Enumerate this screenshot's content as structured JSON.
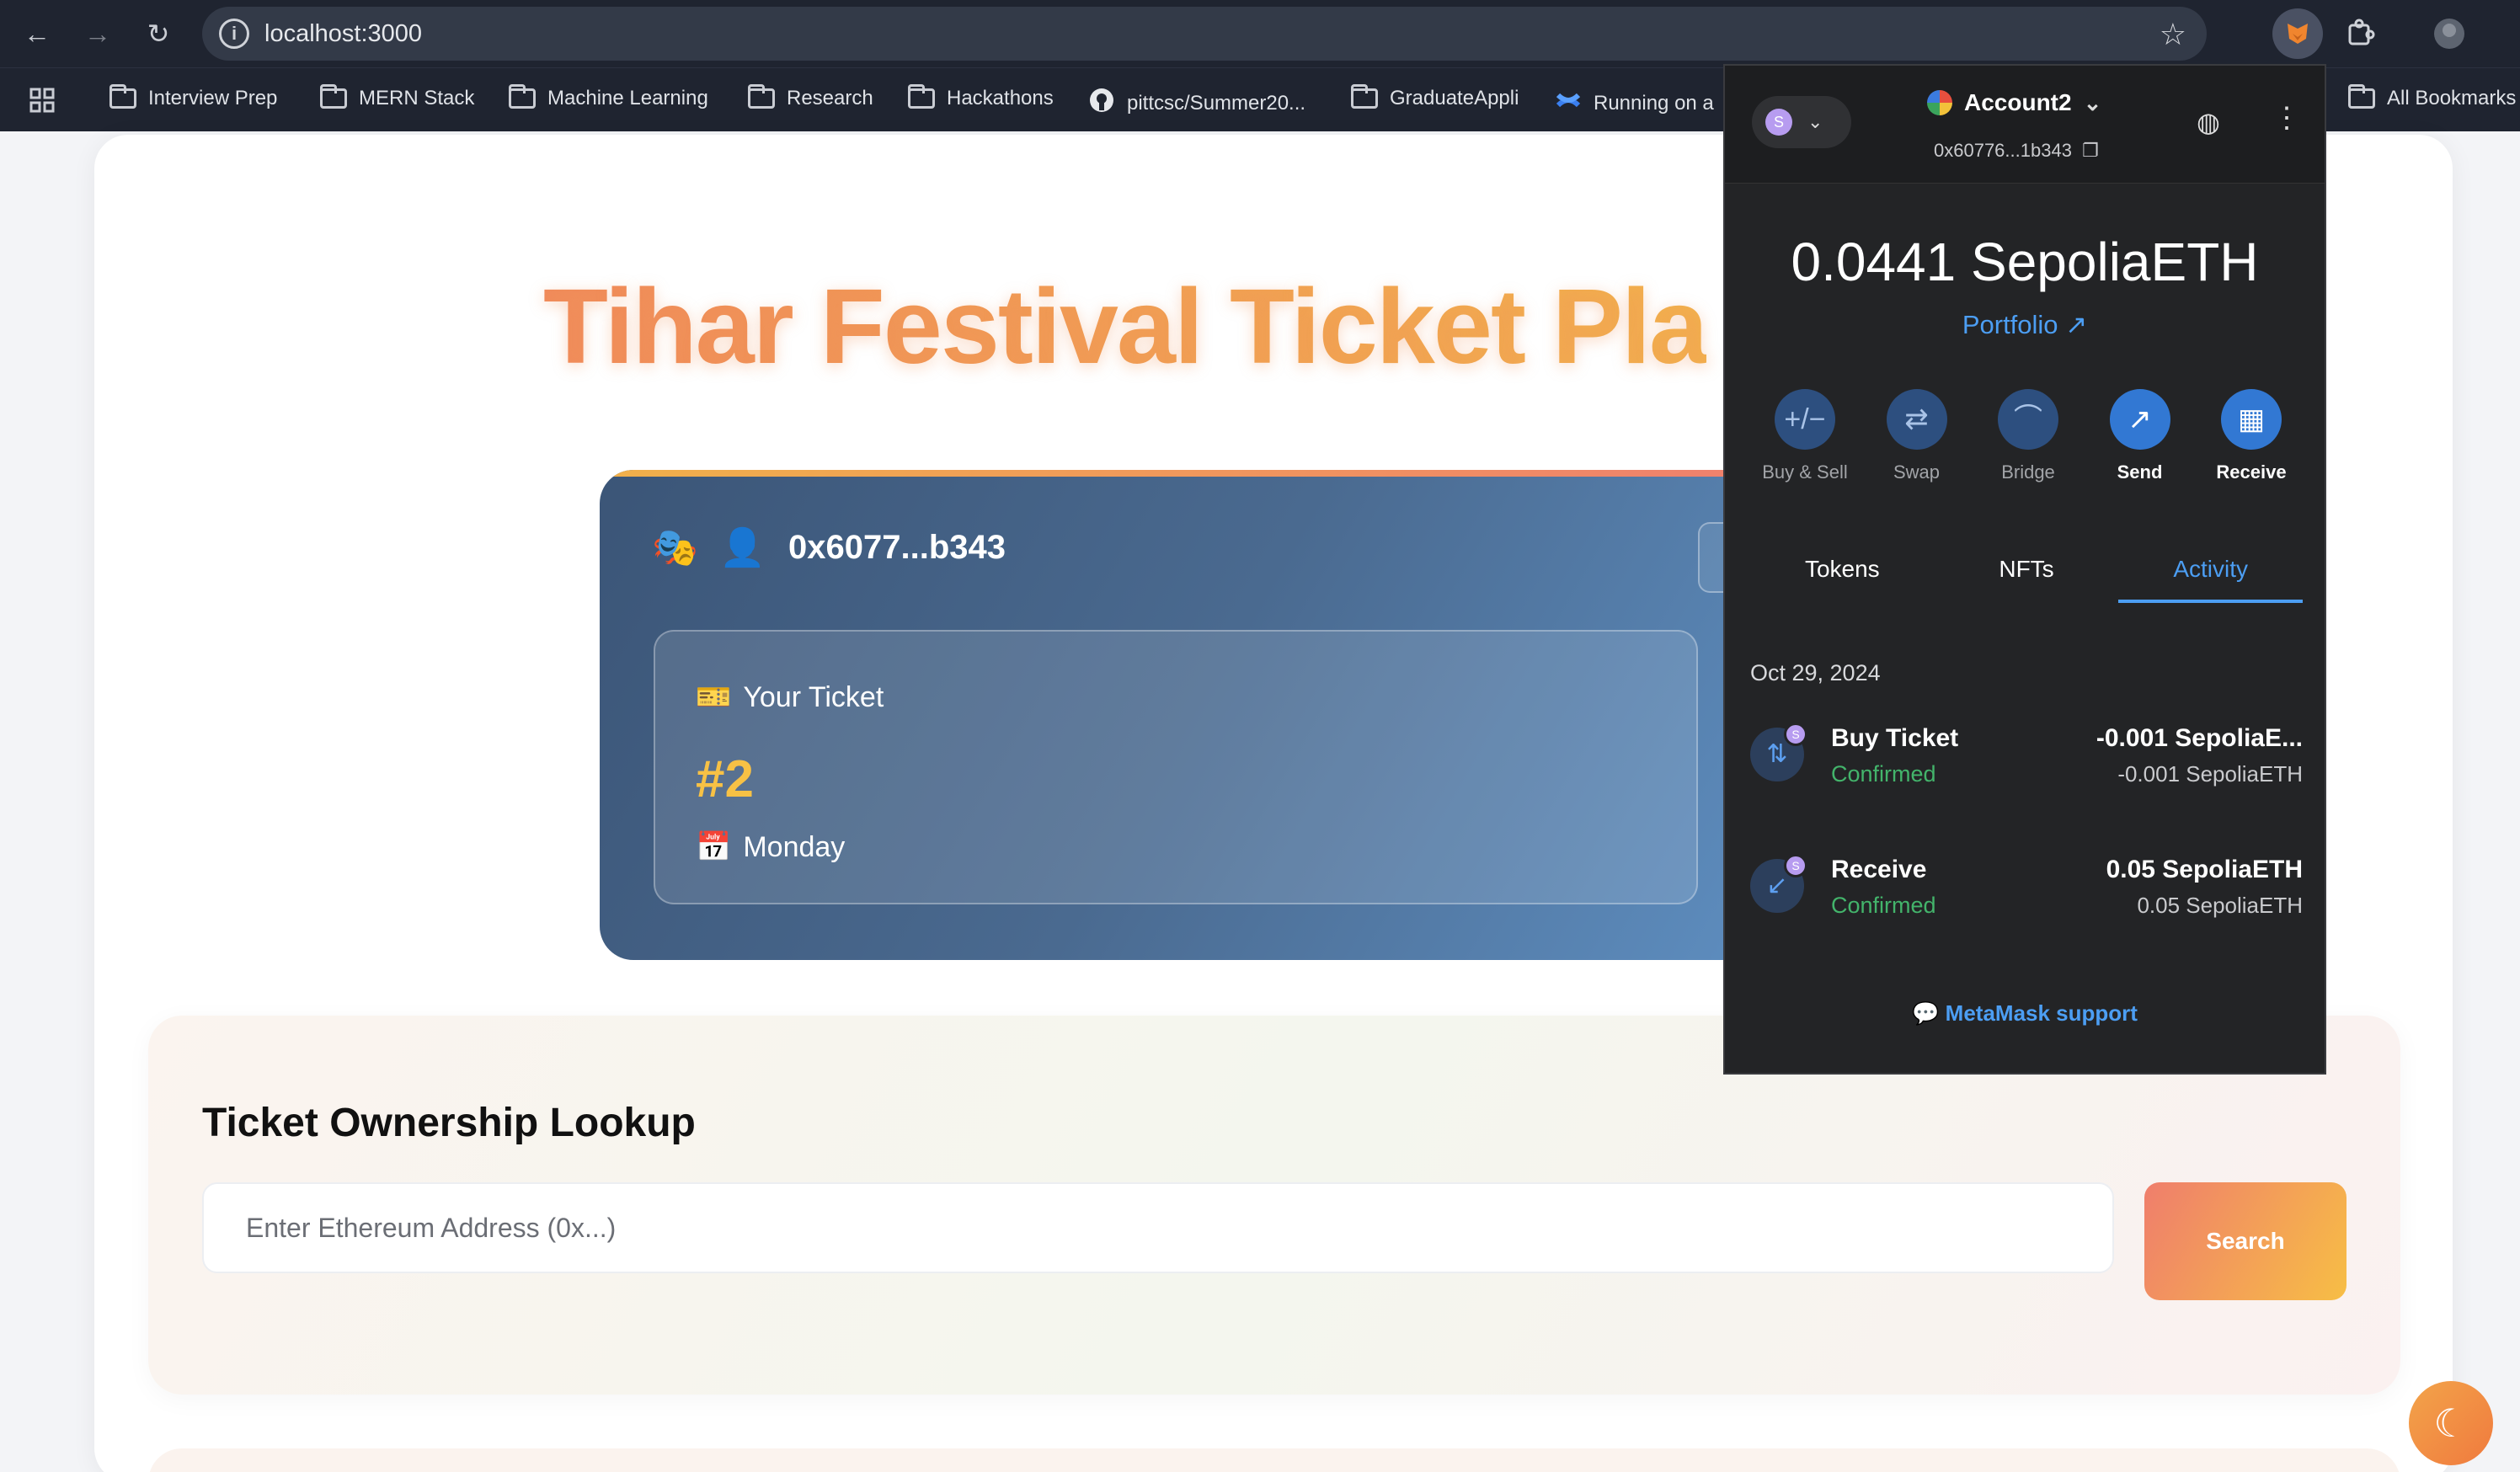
{
  "browser": {
    "url": "localhost:3000",
    "bookmarks": [
      {
        "label": "Interview Prep",
        "icon": "folder-icon"
      },
      {
        "label": "MERN Stack",
        "icon": "folder-icon"
      },
      {
        "label": "Machine Learning",
        "icon": "folder-icon"
      },
      {
        "label": "Research",
        "icon": "folder-icon"
      },
      {
        "label": "Hackathons",
        "icon": "folder-icon"
      },
      {
        "label": "pittcsc/Summer20...",
        "icon": "github-icon"
      },
      {
        "label": "GraduateAppli",
        "icon": "folder-icon"
      },
      {
        "label": "Running on a",
        "icon": "confluence-icon"
      },
      {
        "label": "All Bookmarks",
        "icon": "folder-icon"
      }
    ]
  },
  "page": {
    "title": "Tihar Festival Ticket Pla",
    "ticket_card": {
      "address": "0x6077...b343",
      "ticket_label": "Your Ticket",
      "ticket_number": "#2",
      "day": "Monday",
      "masks_emoji": "🎭",
      "user_emoji": "👤",
      "ticket_emoji": "🎫",
      "calendar_emoji": "📅"
    },
    "lookup": {
      "heading": "Ticket Ownership Lookup",
      "placeholder": "Enter Ethereum Address (0x...)",
      "button": "Search"
    },
    "theme_toggle_icon": "☾"
  },
  "metamask": {
    "network_badge": "S",
    "account_name": "Account2",
    "account_address": "0x60776...1b343",
    "balance": "0.0441 SepoliaETH",
    "portfolio_label": "Portfolio",
    "actions": [
      {
        "label": "Buy & Sell",
        "glyph": "+/−",
        "active": false
      },
      {
        "label": "Swap",
        "glyph": "⇄",
        "active": false
      },
      {
        "label": "Bridge",
        "glyph": "⌒",
        "active": false
      },
      {
        "label": "Send",
        "glyph": "↗",
        "active": true
      },
      {
        "label": "Receive",
        "glyph": "▦",
        "active": true
      }
    ],
    "tabs": [
      "Tokens",
      "NFTs",
      "Activity"
    ],
    "active_tab": "Activity",
    "date": "Oct 29, 2024",
    "transactions": [
      {
        "name": "Buy Ticket",
        "status": "Confirmed",
        "amount": "-0.001 SepoliaE...",
        "amount_sub": "-0.001 SepoliaETH",
        "glyph": "⇅"
      },
      {
        "name": "Receive",
        "status": "Confirmed",
        "amount": "0.05 SepoliaETH",
        "amount_sub": "0.05 SepoliaETH",
        "glyph": "↙"
      }
    ],
    "support_label": "MetaMask support"
  },
  "colors": {
    "title_gradient_start": "#f08a5a",
    "title_gradient_end": "#f2b24c",
    "activity_blue": "#4c9ef3",
    "confirmed_green": "#43b46b"
  }
}
